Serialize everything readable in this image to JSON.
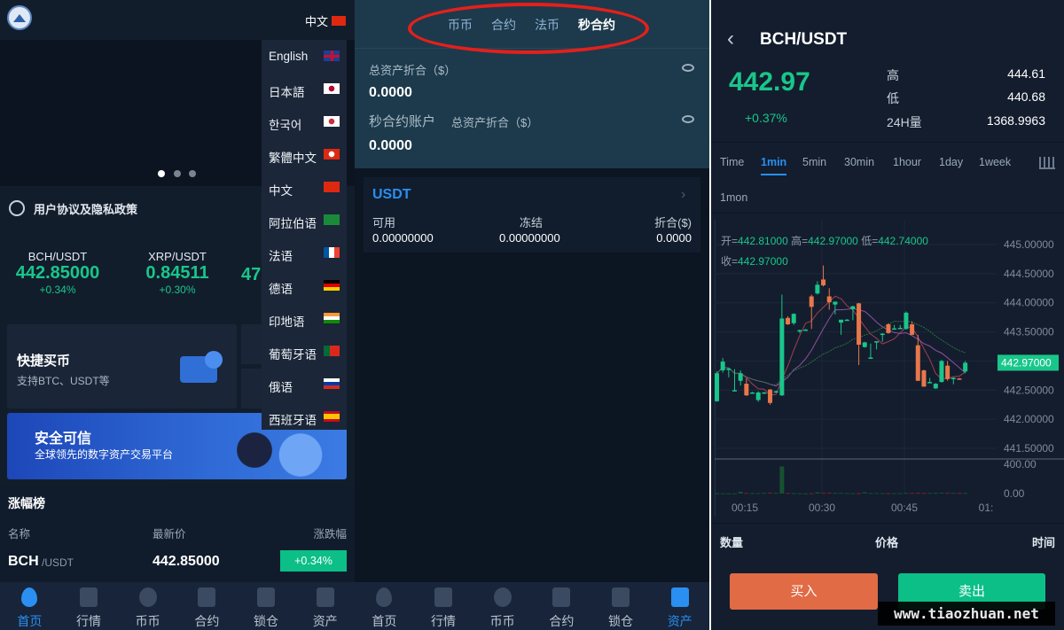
{
  "home": {
    "language_current": "中文",
    "notice": "用户协议及隐私政策",
    "tickers": [
      {
        "pair": "BCH/USDT",
        "price": "442.85000",
        "change": "+0.34%"
      },
      {
        "pair": "XRP/USDT",
        "price": "0.84511",
        "change": "+0.30%"
      },
      {
        "pair": "",
        "price": "47",
        "change": ""
      }
    ],
    "quick_buy": {
      "title": "快捷买币",
      "subtitle": "支持BTC、USDT等"
    },
    "banner": {
      "title": "安全可信",
      "subtitle": "全球领先的数字资产交易平台"
    },
    "ranking": {
      "title": "涨幅榜",
      "headers": [
        "名称",
        "最新价",
        "涨跌幅"
      ],
      "rows": [
        {
          "base": "BCH",
          "quote": "/USDT",
          "price": "442.85000",
          "change": "+0.34%"
        }
      ]
    },
    "languages": [
      "English",
      "日本語",
      "한국어",
      "繁體中文",
      "中文",
      "阿拉伯语",
      "法语",
      "德语",
      "印地语",
      "葡萄牙语",
      "俄语",
      "西班牙语"
    ]
  },
  "nav": [
    "首页",
    "行情",
    "币币",
    "合约",
    "锁仓",
    "资产"
  ],
  "assets": {
    "tabs": [
      "币币",
      "合约",
      "法币",
      "秒合约"
    ],
    "total_label": "总资产折合（$）",
    "total_value": "0.0000",
    "sec_account": "秒合约账户",
    "sec_total_label": "总资产折合（$）",
    "sec_total_value": "0.0000",
    "card": {
      "coin": "USDT",
      "headers": [
        "可用",
        "冻结",
        "折合($)"
      ],
      "values": [
        "0.00000000",
        "0.00000000",
        "0.0000"
      ]
    }
  },
  "trade": {
    "pair": "BCH/USDT",
    "price": "442.97",
    "change": "+0.37%",
    "stats": [
      {
        "label": "高",
        "value": "444.61"
      },
      {
        "label": "低",
        "value": "440.68"
      },
      {
        "label": "24H量",
        "value": "1368.9963"
      }
    ],
    "intervals": [
      "Time",
      "1min",
      "5min",
      "30min",
      "1hour",
      "1day",
      "1week",
      "1mon"
    ],
    "active_interval": "1min",
    "ohlc": {
      "open_label": "开=",
      "open": "442.81000",
      "high_label": "高=",
      "high": "442.97000",
      "low_label": "低=",
      "low": "442.74000",
      "close_label": "收=",
      "close": "442.97000"
    },
    "book_headers": [
      "数量",
      "价格",
      "时间"
    ],
    "buy_label": "买入",
    "sell_label": "卖出",
    "colors": {
      "up": "#19c68a",
      "down": "#e9774a",
      "buy": "#e06b45",
      "sell": "#0bbf87",
      "accent": "#2a8ff0"
    }
  },
  "chart_data": {
    "type": "candlestick",
    "y_ticks": [
      "445.00000",
      "444.50000",
      "444.00000",
      "443.50000",
      "443.00000",
      "442.50000",
      "442.00000",
      "441.50000"
    ],
    "ylim": [
      441.5,
      445.0
    ],
    "last_price": "442.97000",
    "volume_ticks": [
      "400.00",
      "0.00"
    ],
    "x_ticks": [
      "00:15",
      "00:30",
      "00:45",
      "01:"
    ],
    "candles": [
      [
        442.31,
        442.82,
        442.3,
        442.79
      ],
      [
        442.84,
        443.05,
        442.8,
        442.99
      ],
      [
        442.87,
        442.88,
        442.72,
        442.87
      ],
      [
        442.5,
        442.86,
        442.48,
        442.5
      ],
      [
        442.66,
        442.84,
        442.58,
        442.79
      ],
      [
        442.61,
        442.7,
        442.4,
        442.41
      ],
      [
        442.46,
        442.47,
        442.44,
        442.46
      ],
      [
        442.33,
        442.48,
        442.3,
        442.46
      ],
      [
        442.46,
        442.47,
        442.45,
        442.46
      ],
      [
        442.51,
        442.52,
        442.25,
        442.28
      ],
      [
        442.48,
        442.49,
        442.46,
        442.48
      ],
      [
        442.41,
        444.14,
        442.4,
        443.73
      ],
      [
        443.74,
        443.77,
        443.62,
        443.63
      ],
      [
        443.65,
        443.82,
        443.62,
        443.81
      ],
      [
        443.53,
        443.54,
        443.48,
        443.53
      ],
      [
        443.54,
        443.55,
        443.53,
        443.54
      ],
      [
        444.11,
        444.14,
        443.55,
        443.93
      ],
      [
        444.16,
        444.37,
        444.14,
        444.31
      ],
      [
        444.4,
        444.64,
        444.28,
        444.3
      ],
      [
        444.11,
        444.25,
        443.88,
        444.01
      ],
      [
        443.97,
        444.0,
        443.8,
        444.02
      ],
      [
        443.66,
        443.7,
        443.45,
        443.71
      ],
      [
        443.71,
        443.72,
        443.7,
        443.71
      ],
      [
        443.89,
        443.95,
        443.7,
        443.94
      ],
      [
        443.99,
        444.0,
        442.93,
        443.28
      ],
      [
        443.24,
        443.33,
        443.23,
        443.32
      ],
      [
        443.06,
        443.3,
        443.05,
        443.06
      ],
      [
        443.33,
        443.34,
        443.2,
        443.34
      ],
      [
        443.46,
        443.48,
        443.33,
        443.47
      ],
      [
        443.63,
        443.65,
        443.47,
        443.48
      ],
      [
        443.55,
        443.62,
        443.54,
        443.56
      ],
      [
        443.57,
        443.62,
        443.56,
        443.57
      ],
      [
        443.55,
        443.85,
        443.54,
        443.83
      ],
      [
        443.63,
        443.68,
        443.45,
        443.45
      ],
      [
        443.27,
        443.45,
        442.66,
        442.66
      ],
      [
        442.84,
        442.85,
        442.56,
        442.56
      ],
      [
        442.64,
        442.71,
        442.63,
        442.64
      ],
      [
        442.53,
        442.62,
        442.52,
        442.61
      ],
      [
        442.64,
        443.02,
        442.63,
        443.0
      ],
      [
        442.92,
        443.0,
        442.66,
        442.69
      ],
      [
        442.71,
        442.72,
        442.6,
        442.71
      ],
      [
        442.7,
        442.71,
        442.68,
        442.69
      ],
      [
        442.82,
        443.0,
        442.79,
        442.97
      ]
    ],
    "volumes": [
      5,
      4,
      3,
      3,
      25,
      8,
      6,
      6,
      10,
      12,
      9,
      370,
      8,
      5,
      4,
      3,
      4,
      18,
      10,
      12,
      9,
      8,
      6,
      5,
      6,
      18,
      7,
      6,
      6,
      5,
      5,
      6,
      8,
      9,
      10,
      9,
      8,
      10,
      12,
      10,
      9,
      8,
      7
    ]
  }
}
